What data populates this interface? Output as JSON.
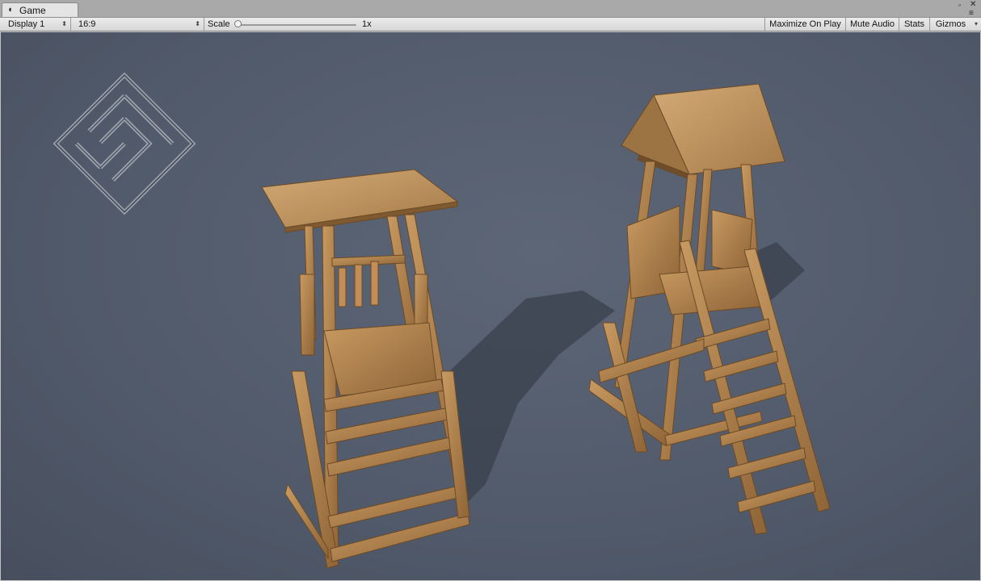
{
  "tab": {
    "icon": "unity-game-icon",
    "label": "Game"
  },
  "window_controls": {
    "maximize": "▫",
    "close": "✕",
    "menu": "≡"
  },
  "toolbar": {
    "display": "Display 1",
    "aspect": "16:9",
    "scale_label": "Scale",
    "scale_value": "1x",
    "scale_level": 0.0,
    "maximize_on_play": "Maximize On Play",
    "mute_audio": "Mute Audio",
    "stats": "Stats",
    "gizmos": "Gizmos"
  },
  "viewport": {
    "background_color": "#555e6e",
    "wood_color": "#b0804e",
    "logo_icon": "maze-diamond-logo",
    "objects": [
      "watchtower-flat-roof",
      "watchtower-gable-roof"
    ]
  }
}
